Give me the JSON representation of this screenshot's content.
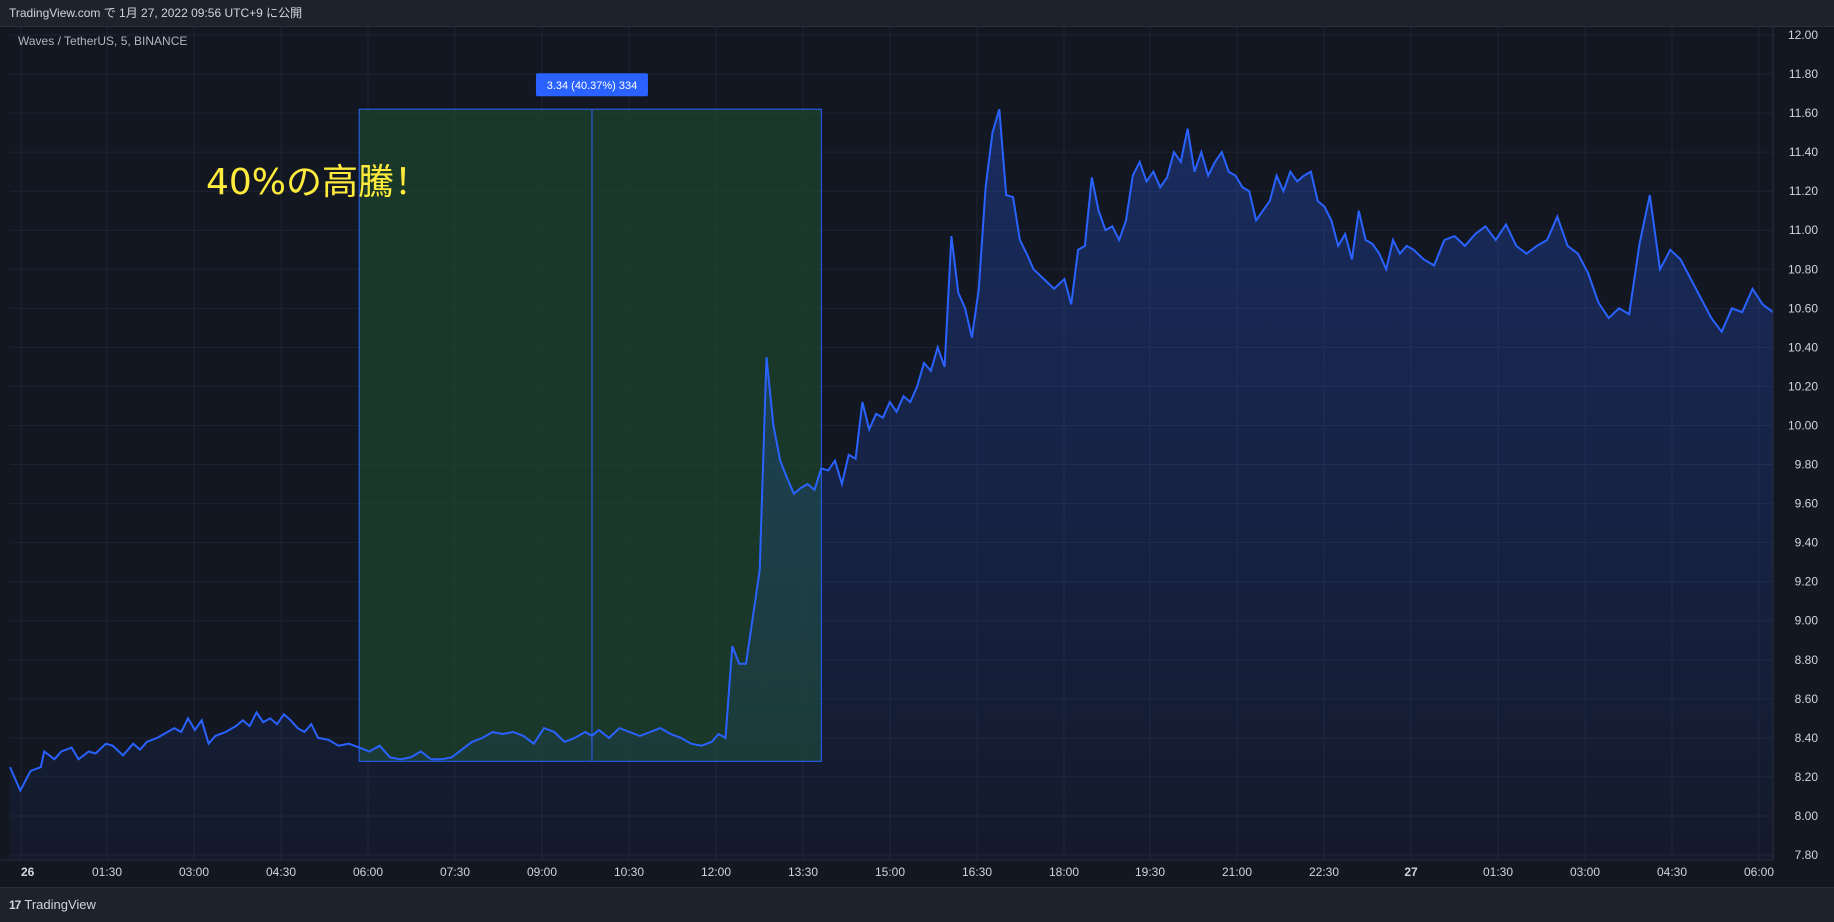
{
  "header": {
    "published_text": "TradingView.com で 1月 27, 2022 09:56 UTC+9 に公開"
  },
  "footer": {
    "logo_mark": "17",
    "logo_text": "TradingView"
  },
  "colors": {
    "background": "#131722",
    "line": "#2962ff",
    "range_fill": "#1f4a2e",
    "grid": "#1f2330",
    "axis_text": "#d1d4dc",
    "annotation": "#ffeb3b",
    "badge": "#2962ff"
  },
  "chart_data": {
    "type": "area",
    "symbol_label": "Waves / TetherUS, 5, BINANCE",
    "annotation": "40%の高騰！",
    "range_label": "3.34 (40.37%) 334",
    "range": {
      "x_start": 10.2,
      "x_end": 23.7,
      "y_low": 8.28,
      "y_high": 11.62,
      "x_measure": 17.0
    },
    "x_ticks": [
      "26",
      "01:30",
      "03:00",
      "04:30",
      "06:00",
      "07:30",
      "09:00",
      "10:30",
      "12:00",
      "13:30",
      "15:00",
      "16:30",
      "18:00",
      "19:30",
      "21:00",
      "22:30",
      "27",
      "01:30",
      "03:00",
      "04:30",
      "06:00"
    ],
    "y_ticks": [
      "12.00",
      "11.80",
      "11.60",
      "11.40",
      "11.20",
      "11.00",
      "10.80",
      "10.60",
      "10.40",
      "10.20",
      "10.00",
      "9.80",
      "9.60",
      "9.40",
      "9.20",
      "9.00",
      "8.80",
      "8.60",
      "8.40",
      "8.20",
      "8.00",
      "7.80"
    ],
    "ylim": [
      7.8,
      12.0
    ],
    "xlim": [
      0,
      41
    ],
    "series": [
      {
        "values": [
          [
            0,
            8.25
          ],
          [
            0.3,
            8.13
          ],
          [
            0.6,
            8.23
          ],
          [
            0.9,
            8.25
          ],
          [
            1.0,
            8.33
          ],
          [
            1.3,
            8.29
          ],
          [
            1.5,
            8.33
          ],
          [
            1.8,
            8.35
          ],
          [
            2.0,
            8.29
          ],
          [
            2.3,
            8.33
          ],
          [
            2.5,
            8.32
          ],
          [
            2.8,
            8.37
          ],
          [
            3.0,
            8.36
          ],
          [
            3.3,
            8.31
          ],
          [
            3.6,
            8.37
          ],
          [
            3.8,
            8.34
          ],
          [
            4.0,
            8.38
          ],
          [
            4.3,
            8.4
          ],
          [
            4.5,
            8.42
          ],
          [
            4.8,
            8.45
          ],
          [
            5.0,
            8.43
          ],
          [
            5.2,
            8.5
          ],
          [
            5.4,
            8.44
          ],
          [
            5.6,
            8.49
          ],
          [
            5.8,
            8.37
          ],
          [
            6.0,
            8.41
          ],
          [
            6.3,
            8.43
          ],
          [
            6.6,
            8.46
          ],
          [
            6.8,
            8.49
          ],
          [
            7.0,
            8.46
          ],
          [
            7.2,
            8.53
          ],
          [
            7.4,
            8.48
          ],
          [
            7.6,
            8.5
          ],
          [
            7.8,
            8.47
          ],
          [
            8.0,
            8.52
          ],
          [
            8.2,
            8.49
          ],
          [
            8.4,
            8.45
          ],
          [
            8.6,
            8.43
          ],
          [
            8.8,
            8.47
          ],
          [
            9.0,
            8.4
          ],
          [
            9.3,
            8.39
          ],
          [
            9.6,
            8.36
          ],
          [
            9.9,
            8.37
          ],
          [
            10.2,
            8.35
          ],
          [
            10.5,
            8.33
          ],
          [
            10.8,
            8.36
          ],
          [
            11.1,
            8.3
          ],
          [
            11.4,
            8.29
          ],
          [
            11.7,
            8.3
          ],
          [
            12.0,
            8.33
          ],
          [
            12.3,
            8.29
          ],
          [
            12.6,
            8.29
          ],
          [
            12.9,
            8.3
          ],
          [
            13.2,
            8.34
          ],
          [
            13.5,
            8.38
          ],
          [
            13.8,
            8.4
          ],
          [
            14.1,
            8.43
          ],
          [
            14.4,
            8.42
          ],
          [
            14.7,
            8.43
          ],
          [
            15.0,
            8.41
          ],
          [
            15.3,
            8.37
          ],
          [
            15.6,
            8.45
          ],
          [
            15.9,
            8.43
          ],
          [
            16.2,
            8.38
          ],
          [
            16.5,
            8.4
          ],
          [
            16.8,
            8.43
          ],
          [
            17.0,
            8.41
          ],
          [
            17.2,
            8.44
          ],
          [
            17.5,
            8.4
          ],
          [
            17.8,
            8.45
          ],
          [
            18.1,
            8.43
          ],
          [
            18.4,
            8.41
          ],
          [
            18.7,
            8.43
          ],
          [
            19.0,
            8.45
          ],
          [
            19.3,
            8.42
          ],
          [
            19.6,
            8.4
          ],
          [
            19.9,
            8.37
          ],
          [
            20.2,
            8.36
          ],
          [
            20.5,
            8.38
          ],
          [
            20.7,
            8.42
          ],
          [
            20.9,
            8.4
          ],
          [
            21.1,
            8.87
          ],
          [
            21.3,
            8.78
          ],
          [
            21.5,
            8.78
          ],
          [
            21.7,
            9.02
          ],
          [
            21.9,
            9.26
          ],
          [
            22.1,
            10.35
          ],
          [
            22.3,
            10.0
          ],
          [
            22.5,
            9.82
          ],
          [
            22.7,
            9.73
          ],
          [
            22.9,
            9.65
          ],
          [
            23.1,
            9.68
          ],
          [
            23.3,
            9.7
          ],
          [
            23.5,
            9.67
          ],
          [
            23.7,
            9.78
          ],
          [
            23.9,
            9.77
          ],
          [
            24.1,
            9.82
          ],
          [
            24.3,
            9.7
          ],
          [
            24.5,
            9.85
          ],
          [
            24.7,
            9.83
          ],
          [
            24.9,
            10.12
          ],
          [
            25.1,
            9.98
          ],
          [
            25.3,
            10.06
          ],
          [
            25.5,
            10.04
          ],
          [
            25.7,
            10.12
          ],
          [
            25.9,
            10.07
          ],
          [
            26.1,
            10.15
          ],
          [
            26.3,
            10.12
          ],
          [
            26.5,
            10.2
          ],
          [
            26.7,
            10.32
          ],
          [
            26.9,
            10.28
          ],
          [
            27.1,
            10.4
          ],
          [
            27.3,
            10.3
          ],
          [
            27.5,
            10.97
          ],
          [
            27.7,
            10.68
          ],
          [
            27.9,
            10.6
          ],
          [
            28.1,
            10.45
          ],
          [
            28.3,
            10.7
          ],
          [
            28.5,
            11.22
          ],
          [
            28.7,
            11.5
          ],
          [
            28.9,
            11.62
          ],
          [
            29.1,
            11.18
          ],
          [
            29.3,
            11.17
          ],
          [
            29.5,
            10.95
          ],
          [
            29.7,
            10.88
          ],
          [
            29.9,
            10.8
          ],
          [
            30.2,
            10.75
          ],
          [
            30.5,
            10.7
          ],
          [
            30.8,
            10.75
          ],
          [
            31.0,
            10.62
          ],
          [
            31.2,
            10.9
          ],
          [
            31.4,
            10.92
          ],
          [
            31.6,
            11.27
          ],
          [
            31.8,
            11.1
          ],
          [
            32.0,
            11.0
          ],
          [
            32.2,
            11.02
          ],
          [
            32.4,
            10.95
          ],
          [
            32.6,
            11.05
          ],
          [
            32.8,
            11.28
          ],
          [
            33.0,
            11.35
          ],
          [
            33.2,
            11.25
          ],
          [
            33.4,
            11.3
          ],
          [
            33.6,
            11.22
          ],
          [
            33.8,
            11.27
          ],
          [
            34.0,
            11.4
          ],
          [
            34.2,
            11.35
          ],
          [
            34.4,
            11.52
          ],
          [
            34.6,
            11.3
          ],
          [
            34.8,
            11.4
          ],
          [
            35.0,
            11.28
          ],
          [
            35.2,
            11.35
          ],
          [
            35.4,
            11.4
          ],
          [
            35.6,
            11.3
          ],
          [
            35.8,
            11.28
          ],
          [
            36.0,
            11.22
          ],
          [
            36.2,
            11.2
          ],
          [
            36.4,
            11.05
          ],
          [
            36.6,
            11.1
          ],
          [
            36.8,
            11.15
          ],
          [
            37.0,
            11.28
          ],
          [
            37.2,
            11.2
          ],
          [
            37.4,
            11.3
          ],
          [
            37.6,
            11.25
          ],
          [
            37.8,
            11.28
          ],
          [
            38.0,
            11.3
          ],
          [
            38.2,
            11.15
          ],
          [
            38.4,
            11.12
          ],
          [
            38.6,
            11.05
          ],
          [
            38.8,
            10.92
          ],
          [
            39.0,
            10.98
          ],
          [
            39.2,
            10.85
          ],
          [
            39.4,
            11.1
          ],
          [
            39.6,
            10.95
          ],
          [
            39.8,
            10.93
          ],
          [
            40.0,
            10.88
          ],
          [
            40.2,
            10.8
          ],
          [
            40.4,
            10.95
          ],
          [
            40.6,
            10.88
          ],
          [
            40.8,
            10.92
          ],
          [
            41.0,
            10.9
          ]
        ]
      }
    ],
    "series_right": [
      [
        41.0,
        10.9
      ],
      [
        41.3,
        10.85
      ],
      [
        41.6,
        10.82
      ],
      [
        41.9,
        10.95
      ],
      [
        42.2,
        10.97
      ],
      [
        42.5,
        10.92
      ],
      [
        42.8,
        10.98
      ],
      [
        43.1,
        11.02
      ],
      [
        43.4,
        10.95
      ],
      [
        43.7,
        11.03
      ],
      [
        44.0,
        10.92
      ],
      [
        44.3,
        10.88
      ],
      [
        44.6,
        10.92
      ],
      [
        44.9,
        10.95
      ],
      [
        45.2,
        11.07
      ],
      [
        45.5,
        10.92
      ],
      [
        45.8,
        10.88
      ],
      [
        46.1,
        10.78
      ],
      [
        46.4,
        10.63
      ],
      [
        46.7,
        10.55
      ],
      [
        47.0,
        10.6
      ],
      [
        47.3,
        10.57
      ],
      [
        47.6,
        10.93
      ],
      [
        47.9,
        11.18
      ],
      [
        48.2,
        10.8
      ],
      [
        48.5,
        10.9
      ],
      [
        48.8,
        10.85
      ],
      [
        49.1,
        10.75
      ],
      [
        49.4,
        10.65
      ],
      [
        49.7,
        10.55
      ],
      [
        50.0,
        10.48
      ],
      [
        50.3,
        10.6
      ],
      [
        50.6,
        10.58
      ],
      [
        50.9,
        10.7
      ],
      [
        51.2,
        10.62
      ],
      [
        51.5,
        10.58
      ]
    ]
  }
}
